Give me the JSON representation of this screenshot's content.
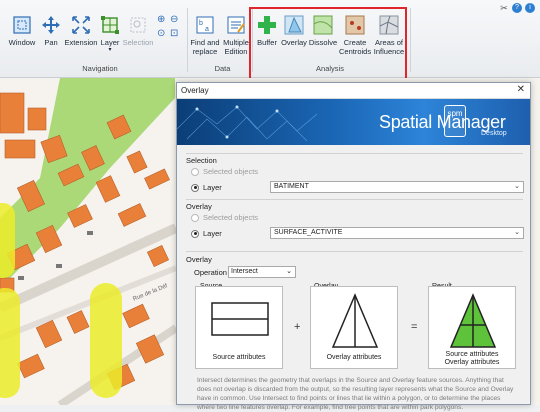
{
  "ribbon": {
    "buttons": {
      "window": "Window",
      "pan": "Pan",
      "extension": "Extension",
      "layer": "Layer",
      "selection": "Selection",
      "find_replace": "Find and replace",
      "multiple_edition": "Multiple Edition",
      "buffer": "Buffer",
      "overlay": "Overlay",
      "dissolve": "Dissolve",
      "create_centroids": "Create Centroids",
      "areas_of_influence": "Areas of Influence"
    },
    "groups": {
      "navigation": "Navigation",
      "data": "Data",
      "analysis": "Analysis"
    }
  },
  "map": {
    "street_label": "Rue de la Déf"
  },
  "dialog": {
    "title": "Overlay",
    "close_glyph": "✕",
    "banner": {
      "title": "Spatial Manager",
      "badge": "spm",
      "subtitle": "Desktop"
    },
    "selection": {
      "title": "Selection",
      "selected_objects": "Selected objects",
      "layer_label": "Layer",
      "layer_value": "BATIMENT"
    },
    "overlay": {
      "title": "Overlay",
      "selected_objects": "Selected objects",
      "layer_label": "Layer",
      "layer_value": "SURFACE_ACTIVITE"
    },
    "operation": {
      "section_title": "Overlay",
      "label": "Operation",
      "value": "Intersect"
    },
    "diagram": {
      "source_title": "Source",
      "overlay_title": "Overlay",
      "result_title": "Result",
      "plus": "+",
      "equals": "=",
      "source_caption": "Source attributes",
      "overlay_caption": "Overlay attributes",
      "result_caption_1": "Source attributes",
      "result_caption_2": "Overlay attributes"
    },
    "description": "Intersect determines the geometry that overlaps in the Source and Overlay feature sources. Anything that does not overlap is discarded from the output, so the resulting layer represents what the Source and Overlay have in common. Use Intersect to find points or lines that lie within a polygon, or to determine the places where two line features overlap. For example, find tree points that are within park polygons."
  },
  "colors": {
    "highlight_red": "#e0252c",
    "banner_blue": "#1b67b6",
    "road_green": "#a4d66a",
    "building_orange": "#e8803a",
    "buffer_yellow": "#ecec2a",
    "result_green": "#5ec23a"
  },
  "icons": [
    "window-icon",
    "pan-icon",
    "extension-icon",
    "layer-icon",
    "selection-icon",
    "zoom-in-icon",
    "zoom-out-icon",
    "find-replace-icon",
    "multiple-edition-icon",
    "buffer-icon",
    "overlay-icon",
    "dissolve-icon",
    "create-centroids-icon",
    "areas-of-influence-icon",
    "tools-icon",
    "help-icon",
    "settings-icon"
  ]
}
